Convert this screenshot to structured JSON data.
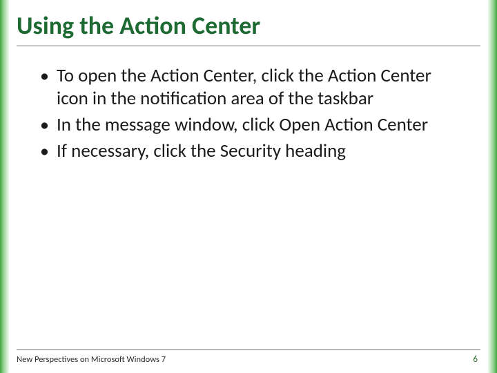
{
  "colors": {
    "accent_green": "#1d6a32",
    "edge_gradient_start": "#3fa63f"
  },
  "title": "Using the Action Center",
  "bullets": [
    "To open the Action Center, click the Action Center icon in the notification area of the taskbar",
    "In the message window, click Open Action Center",
    "If necessary, click the Security heading"
  ],
  "footer": {
    "source": "New Perspectives on Microsoft Windows 7",
    "page_number": "6"
  }
}
